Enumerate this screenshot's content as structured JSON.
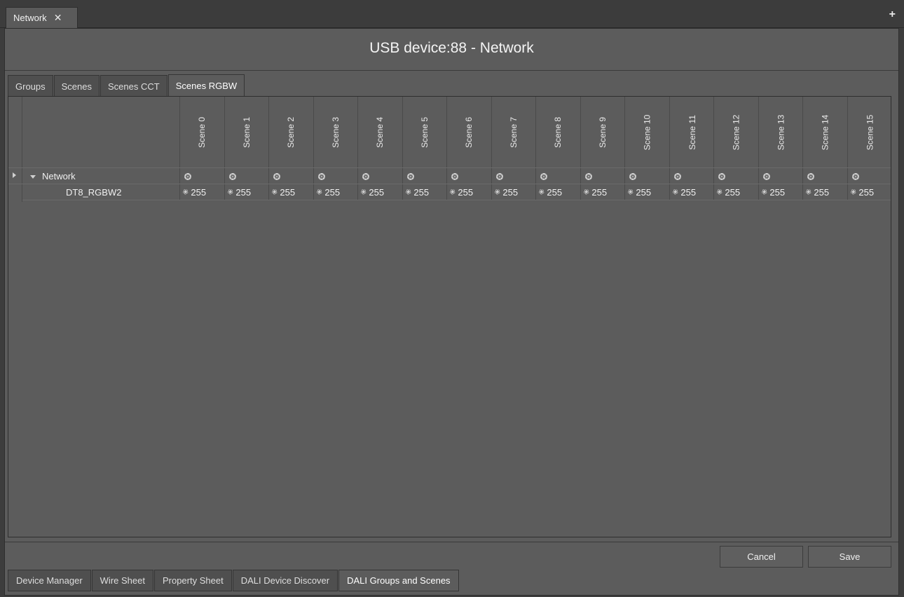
{
  "window_tab": {
    "label": "Network",
    "close": "✕",
    "add": "+"
  },
  "title": "USB device:88 - Network",
  "sub_tabs": [
    "Groups",
    "Scenes",
    "Scenes CCT",
    "Scenes RGBW"
  ],
  "active_sub_tab": "Scenes RGBW",
  "columns": [
    "Scene 0",
    "Scene 1",
    "Scene 2",
    "Scene 3",
    "Scene 4",
    "Scene 5",
    "Scene 6",
    "Scene 7",
    "Scene 8",
    "Scene 9",
    "Scene 10",
    "Scene 11",
    "Scene 12",
    "Scene 13",
    "Scene 14",
    "Scene 15"
  ],
  "tree": {
    "root": {
      "label": "Network"
    },
    "child": {
      "label": "DT8_RGBW2",
      "values": [
        "255",
        "255",
        "255",
        "255",
        "255",
        "255",
        "255",
        "255",
        "255",
        "255",
        "255",
        "255",
        "255",
        "255",
        "255",
        "255"
      ]
    }
  },
  "buttons": {
    "cancel": "Cancel",
    "save": "Save"
  },
  "view_tabs": [
    "Device Manager",
    "Wire Sheet",
    "Property Sheet",
    "DALI Device Discover",
    "DALI Groups and Scenes"
  ],
  "active_view_tab": "DALI Groups and Scenes",
  "icons": {
    "expand": "chevron-right-icon",
    "collapse": "chevron-down-icon",
    "group_scene": "gear-icon",
    "level": "fan-icon"
  },
  "colors": {
    "background": "#5c5c5c",
    "frame": "#3d3d3d",
    "text": "#f0f0f0"
  }
}
